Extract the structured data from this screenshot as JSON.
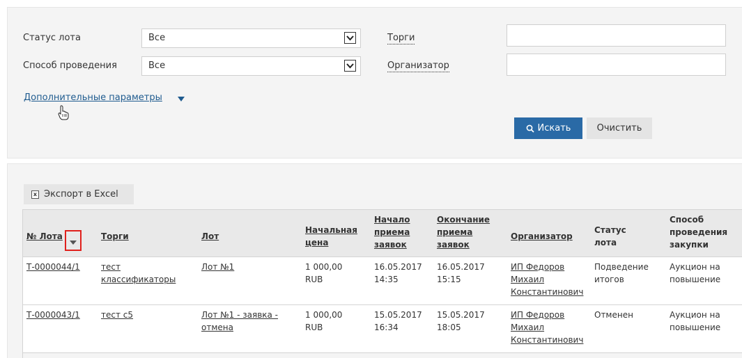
{
  "filters": {
    "lot_status_label": "Статус лота",
    "lot_status_value": "Все",
    "method_label": "Способ проведения",
    "method_value": "Все",
    "auction_label": "Торги",
    "auction_value": "",
    "organizer_label": "Организатор",
    "organizer_value": "",
    "more_params_link": "Дополнительные параметры",
    "search_button": "Искать",
    "clear_button": "Очистить"
  },
  "results": {
    "export_button": "Экспорт в Excel",
    "columns": {
      "lot_no": "№ Лота",
      "auction": "Торги",
      "lot": "Лот",
      "start_price": [
        "Начальная",
        "цена"
      ],
      "start_accept": [
        "Начало",
        "приема",
        "заявок"
      ],
      "end_accept": [
        "Окончание",
        "приема",
        "заявок"
      ],
      "organizer": "Организатор",
      "lot_status": [
        "Статус",
        "лота"
      ],
      "purchase_method": [
        "Способ",
        "проведения",
        "закупки"
      ]
    },
    "rows": [
      {
        "lot_no": "Т-0000044/1",
        "auction": [
          "тест",
          "классификаторы"
        ],
        "lot": [
          "Лот №1"
        ],
        "price": [
          "1 000,00",
          "RUB"
        ],
        "start": [
          "16.05.2017",
          "14:35"
        ],
        "end": [
          "16.05.2017",
          "15:15"
        ],
        "organizer": [
          "ИП Федоров",
          "Михаил",
          "Константинович"
        ],
        "status": [
          "Подведение",
          "итогов"
        ],
        "method": [
          "Аукцион на",
          "повышение"
        ]
      },
      {
        "lot_no": "Т-0000043/1",
        "auction": [
          "тест с5"
        ],
        "lot": [
          "Лот №1 - заявка -",
          "отмена"
        ],
        "price": [
          "1 000,00",
          "RUB"
        ],
        "start": [
          "15.05.2017",
          "16:34"
        ],
        "end": [
          "15.05.2017",
          "18:05"
        ],
        "organizer": [
          "ИП Федоров",
          "Михаил",
          "Константинович"
        ],
        "status": [
          "Отменен"
        ],
        "method": [
          "Аукцион на",
          "повышение"
        ]
      }
    ]
  },
  "colors": {
    "primary_button": "#2a6aa6",
    "link": "#1f5b8f",
    "highlight": "#e0201c"
  }
}
